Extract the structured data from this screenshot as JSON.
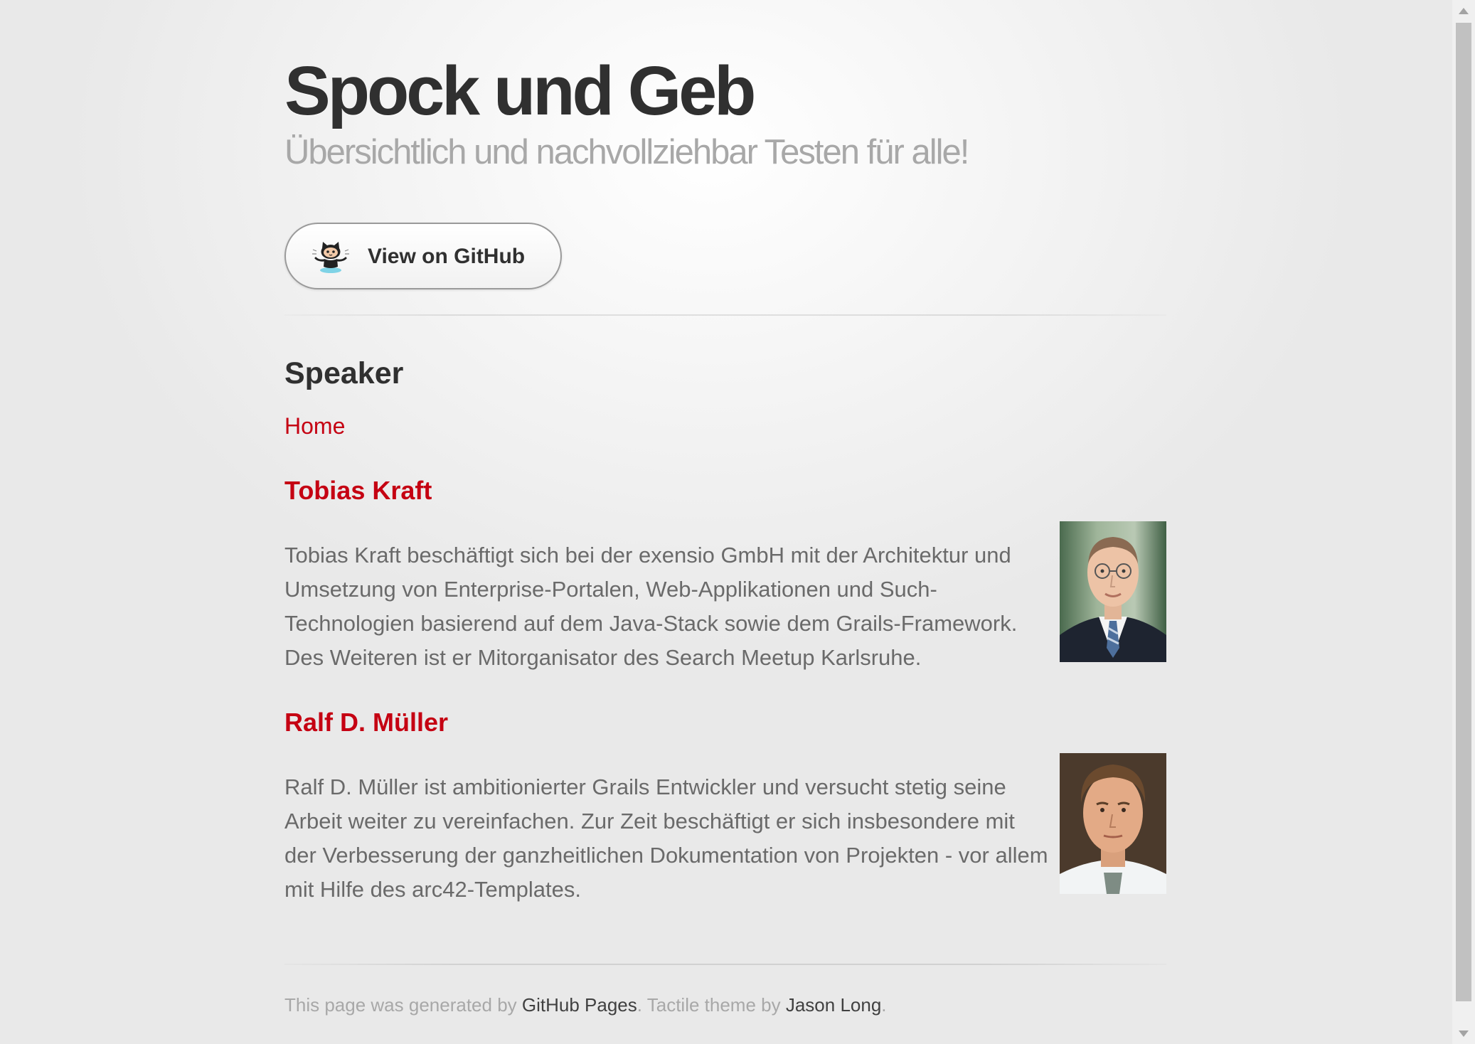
{
  "header": {
    "title": "Spock und Geb",
    "tagline": "Übersichtlich und nachvollziehbar Testen für alle!",
    "github_button_label": "View on GitHub"
  },
  "main": {
    "heading": "Speaker",
    "home_link": "Home",
    "speakers": [
      {
        "name": "Tobias Kraft",
        "bio": "Tobias Kraft beschäftigt sich bei der exensio GmbH mit der Architektur und Umsetzung von Enterprise-Portalen, Web-Applikationen und Such-Technologien basierend auf dem Java-Stack sowie dem Grails-Framework. Des Weiteren ist er Mitorganisator des Search Meetup Karlsruhe."
      },
      {
        "name": "Ralf D. Müller",
        "bio": "Ralf D. Müller ist ambitionierter Grails Entwickler und versucht stetig seine Arbeit weiter zu vereinfachen. Zur Zeit beschäftigt er sich insbesondere mit der Verbesserung der ganzheitlichen Dokumentation von Projekten - vor allem mit Hilfe des arc42-Templates."
      }
    ]
  },
  "footer": {
    "text_prefix": "This page was generated by",
    "github_pages_link": "GitHub Pages",
    "text_middle": ". Tactile theme by",
    "author_link": "Jason Long",
    "text_suffix": "."
  },
  "colors": {
    "accent_red": "#c50012",
    "title_dark": "#303030",
    "tagline_gray": "#a8a8a8",
    "body_text": "#6a6a6a"
  },
  "icons": {
    "github_button": "octocat-icon",
    "scroll_up": "arrow-up-icon",
    "scroll_down": "arrow-down-icon"
  }
}
